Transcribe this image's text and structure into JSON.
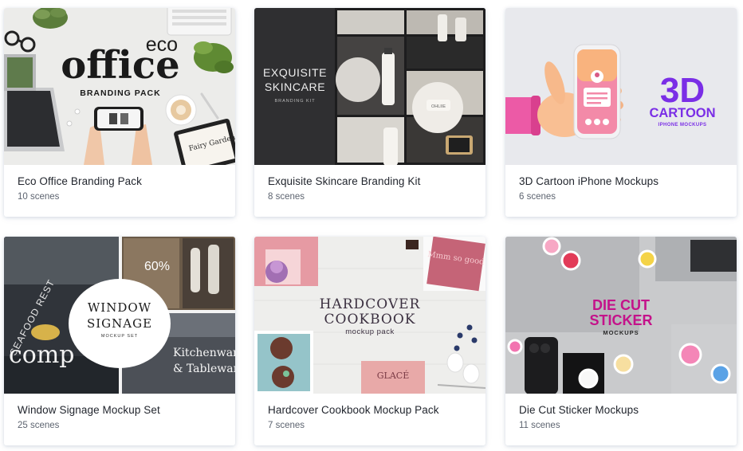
{
  "products": [
    {
      "title": "Eco Office Branding Pack",
      "scenes": "10 scenes",
      "art": {
        "word1": "eco",
        "word2": "office",
        "subtitle": "BRANDING PACK",
        "note": "Fairy Garden"
      }
    },
    {
      "title": "Exquisite Skincare Branding Kit",
      "scenes": "8 scenes",
      "art": {
        "word1": "EXQUISITE",
        "word2": "SKINCARE",
        "subtitle": "BRANDING KIT",
        "tube_label": "OHLIIE"
      }
    },
    {
      "title": "3D Cartoon iPhone Mockups",
      "scenes": "6 scenes",
      "art": {
        "word1": "3D",
        "word2": "CARTOON",
        "subtitle": "IPHONE MOCKUPS"
      }
    },
    {
      "title": "Window Signage Mockup Set",
      "scenes": "25 scenes",
      "art": {
        "word1": "WINDOW",
        "word2": "SIGNAGE",
        "subtitle": "MOCKUP SET",
        "sign1": "SEAFOOD REST",
        "sign2": "comp",
        "sign3": "Kitchenware",
        "sign4": "& Tableware",
        "sale": "60%"
      }
    },
    {
      "title": "Hardcover Cookbook Mockup Pack",
      "scenes": "7 scenes",
      "art": {
        "word1": "HARDCOVER",
        "word2": "COOKBOOK",
        "subtitle": "mockup pack",
        "book_title": "GLACÉ",
        "book_cover": "Mmm so good"
      }
    },
    {
      "title": "Die Cut Sticker Mockups",
      "scenes": "11 scenes",
      "art": {
        "word1": "DIE CUT",
        "word2": "STICKER",
        "subtitle": "MOCKUPS"
      }
    }
  ],
  "colors": {
    "title_text": "#22262e",
    "meta_text": "#5d6470",
    "card_shadow": "#283c6e",
    "cartoon_purple": "#7a2ee6",
    "sticker_magenta": "#c4128a",
    "skincare_dark": "#2f2f31"
  }
}
